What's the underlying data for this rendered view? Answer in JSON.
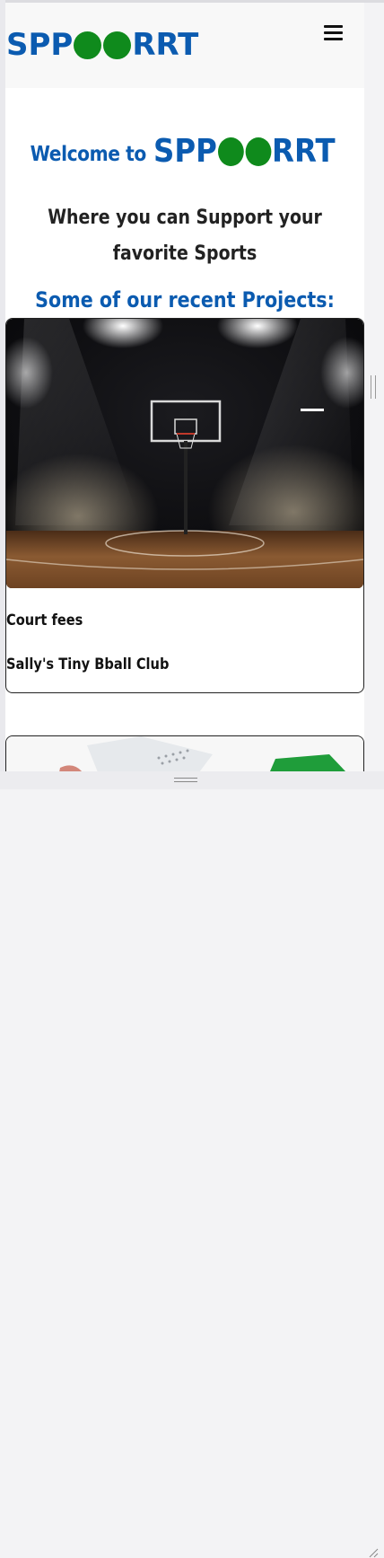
{
  "navbar": {
    "brand_prefix": "SPP",
    "brand_suffix": "RRT",
    "menu_icon": "hamburger-menu-icon"
  },
  "hero": {
    "welcome_text": "Welcome to",
    "brand_prefix": "SPP",
    "brand_suffix": "RRT",
    "tagline": "Where you can Support your favorite Sports",
    "projects_heading": "Some of our recent Projects:"
  },
  "projects": [
    {
      "image": "basketball-court-photo",
      "title": "Court fees",
      "subtitle": "Sally's Tiny Bball Club"
    },
    {
      "image": "sports-equipment-photo"
    }
  ],
  "colors": {
    "brand_blue": "#0b5bb0",
    "brand_green": "#0f8a1c"
  }
}
